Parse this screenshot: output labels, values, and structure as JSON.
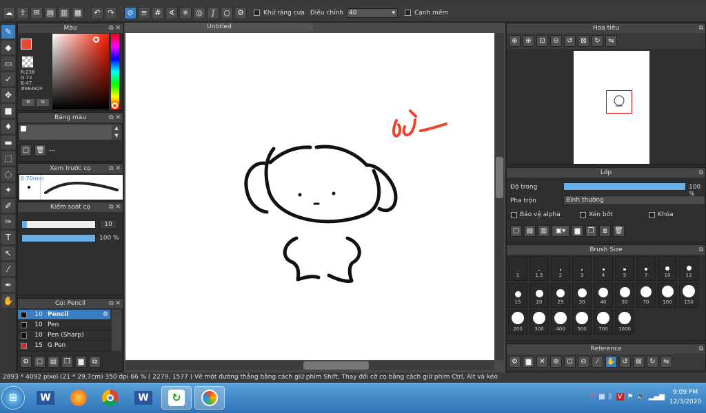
{
  "toolbar": {
    "antialias_label": "Khử răng cưa",
    "correction_label": "Điều chỉnh",
    "correction_value": "40",
    "smooth_edge_label": "Cạnh mềm"
  },
  "color_panel": {
    "title": "Màu",
    "r": "R:238",
    "g": "G:72",
    "b": "B:47",
    "hex": "#EE482F",
    "fg_color": "#ee482f",
    "bg_color": "#0a8a2a"
  },
  "color_set_panel": {
    "title": "Bảng màu",
    "name": "---"
  },
  "brush_preview_panel": {
    "title": "Xem trước cọ",
    "size": "0.70mm"
  },
  "brush_control_panel": {
    "title": "Kiểm soát cọ",
    "size_value": "10",
    "opacity_value": "100 %",
    "size_fraction": 0.07,
    "opacity_fraction": 1.0
  },
  "brush_list_panel": {
    "title": "Cọ: Pencil",
    "items": [
      {
        "size": "10",
        "name": "Pencil",
        "color": "#111111",
        "selected": true
      },
      {
        "size": "10",
        "name": "Pen",
        "color": "#111111",
        "selected": false
      },
      {
        "size": "10",
        "name": "Pen (Sharp)",
        "color": "#111111",
        "selected": false
      },
      {
        "size": "15",
        "name": "G Pen",
        "color": "#e02020",
        "selected": false
      }
    ]
  },
  "document": {
    "tab_title": "Untitled"
  },
  "navigator_panel": {
    "title": "Hoa tiêu"
  },
  "layer_panel": {
    "title": "Lớp",
    "opacity_label": "Độ trong",
    "opacity_value": "100 %",
    "opacity_fraction": 1.0,
    "blend_label": "Pha trộn",
    "blend_value": "Bình thường",
    "protect_alpha": "Bảo vệ alpha",
    "clipping": "Xén bớt",
    "lock": "Khóa"
  },
  "brush_size_panel": {
    "title": "Brush Size",
    "sizes": [
      "1",
      "1.5",
      "2",
      "3",
      "4",
      "5",
      "7",
      "10",
      "12",
      "15",
      "20",
      "25",
      "30",
      "40",
      "50",
      "70",
      "100",
      "150",
      "200",
      "300",
      "400",
      "500",
      "700",
      "1000"
    ]
  },
  "reference_panel": {
    "title": "Reference"
  },
  "status": {
    "text": "2893 * 4092 pixel   (21 * 29.7cm)   350 dpi   66 %   ( 2279, 1577 )   Vẽ một đường thẳng bằng cách giữ phím Shift, Thay đổi cỡ cọ bằng cách giữ phím Ctrl, Alt và kéo"
  },
  "taskbar": {
    "time": "9:09 PM",
    "date": "12/3/2020"
  }
}
